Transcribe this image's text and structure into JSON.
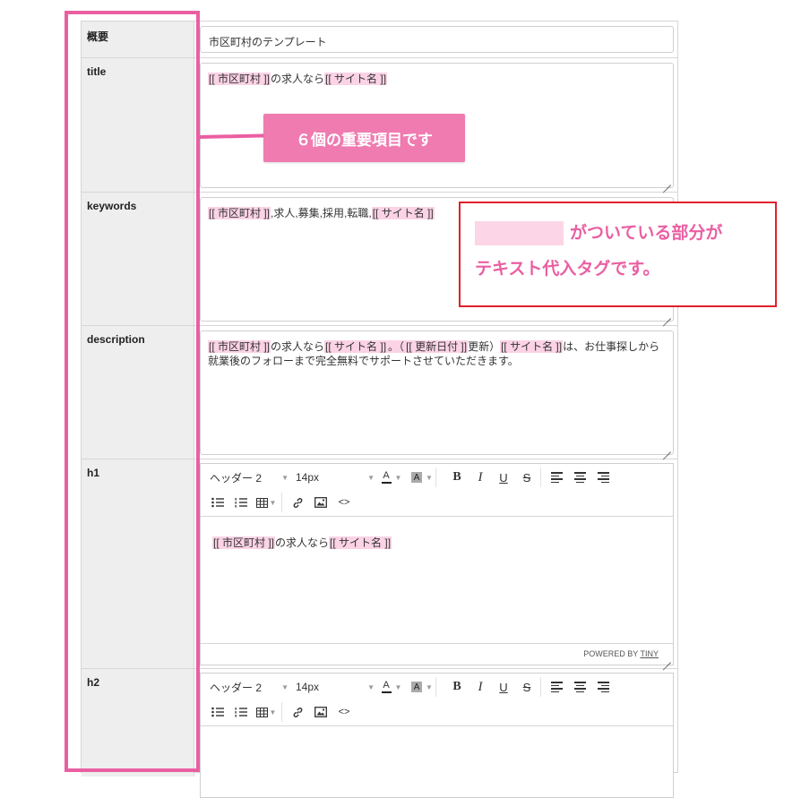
{
  "fields": {
    "overview": {
      "label": "概要",
      "value": "市区町村のテンプレート"
    },
    "title": {
      "label": "title",
      "tag1": "[[ 市区町村 ]]",
      "text1": "の求人なら",
      "tag2": "[[ サイト名 ]]"
    },
    "keywords": {
      "label": "keywords",
      "tag1": "[[ 市区町村 ]]",
      "text1": ",求人,募集,採用,転職,",
      "tag2": "[[ サイト名 ]]"
    },
    "description": {
      "label": "description",
      "tag1": "[[ 市区町村 ]]",
      "text1": "の求人なら",
      "tag2": "[[ サイト名 ]]",
      "text2": "。（",
      "tag3": "[[ 更新日付 ]]",
      "text3": "更新）",
      "tag4": "[[ サイト名 ]]",
      "text4": "は、お仕事探しから就業後のフォローまで完全無料でサポートさせていただきます。"
    },
    "h1": {
      "label": "h1",
      "tag1": "[[ 市区町村 ]]",
      "text1": "の求人なら",
      "tag2": "[[ サイト名 ]]"
    },
    "h2": {
      "label": "h2"
    }
  },
  "editor": {
    "format_select": "ヘッダー 2",
    "size_select": "14px",
    "font_color_glyph": "A",
    "bg_color_glyph": "A",
    "bold": "B",
    "italic": "I",
    "underline": "U",
    "strike": "S",
    "code": "<>",
    "powered_by": "POWERED BY",
    "powered_by_link": "TINY"
  },
  "annotations": {
    "important_items": "６個の重要項目です",
    "tag_note_line1": "がついている部分が",
    "tag_note_line2": "テキスト代入タグです。"
  },
  "colors": {
    "highlight": "#fbd3e5",
    "accent_pink": "#ea5fa2",
    "callout_red": "#e0202a"
  }
}
